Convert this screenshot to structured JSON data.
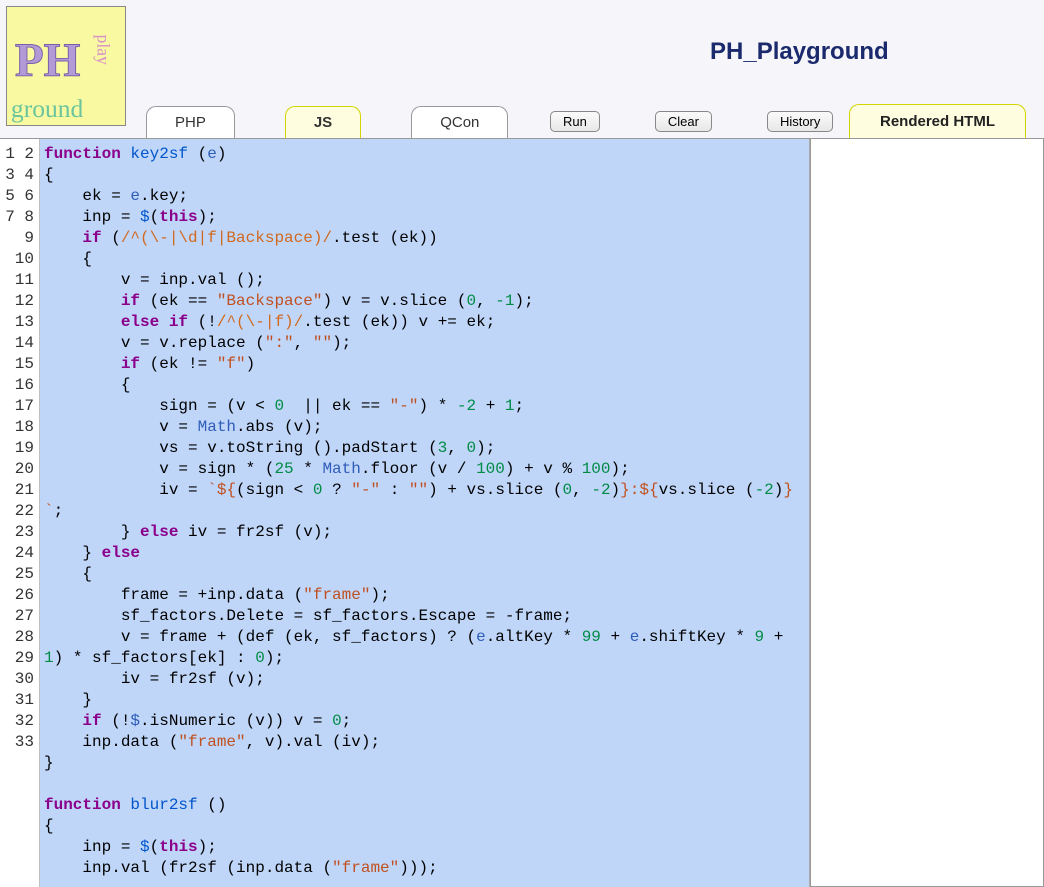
{
  "app_title": "PH_Playground",
  "logo_text": {
    "ph": "PH",
    "play": "play",
    "ground": "ground"
  },
  "tabs": [
    {
      "label": "PHP",
      "active": false
    },
    {
      "label": "JS",
      "active": true
    },
    {
      "label": "QCon",
      "active": false
    }
  ],
  "buttons": {
    "run": "Run",
    "clear": "Clear",
    "history": "History"
  },
  "rendered_tab_label": "Rendered HTML",
  "line_count": 33,
  "code_lines": [
    {
      "n": 1,
      "tokens": [
        {
          "t": "kw",
          "v": "function"
        },
        {
          "t": "",
          "v": " "
        },
        {
          "t": "fn",
          "v": "key2sf"
        },
        {
          "t": "",
          "v": " ("
        },
        {
          "t": "va",
          "v": "e"
        },
        {
          "t": "",
          "v": ")"
        }
      ]
    },
    {
      "n": 2,
      "tokens": [
        {
          "t": "",
          "v": "{"
        }
      ]
    },
    {
      "n": 3,
      "tokens": [
        {
          "t": "",
          "v": "    ek = "
        },
        {
          "t": "va",
          "v": "e"
        },
        {
          "t": "",
          "v": ".key;"
        }
      ]
    },
    {
      "n": 4,
      "tokens": [
        {
          "t": "",
          "v": "    inp = "
        },
        {
          "t": "fn",
          "v": "$"
        },
        {
          "t": "",
          "v": "("
        },
        {
          "t": "kw",
          "v": "this"
        },
        {
          "t": "",
          "v": ");"
        }
      ]
    },
    {
      "n": 5,
      "tokens": [
        {
          "t": "",
          "v": "    "
        },
        {
          "t": "kw",
          "v": "if"
        },
        {
          "t": "",
          "v": " ("
        },
        {
          "t": "re",
          "v": "/^(\\-|\\d|f|Backspace)/"
        },
        {
          "t": "",
          "v": ".test (ek))"
        }
      ]
    },
    {
      "n": 6,
      "tokens": [
        {
          "t": "",
          "v": "    {"
        }
      ]
    },
    {
      "n": 7,
      "tokens": [
        {
          "t": "",
          "v": "        v = inp.val ();"
        }
      ]
    },
    {
      "n": 8,
      "tokens": [
        {
          "t": "",
          "v": "        "
        },
        {
          "t": "kw",
          "v": "if"
        },
        {
          "t": "",
          "v": " (ek == "
        },
        {
          "t": "str",
          "v": "\"Backspace\""
        },
        {
          "t": "",
          "v": ") v = v.slice ("
        },
        {
          "t": "num",
          "v": "0"
        },
        {
          "t": "",
          "v": ", "
        },
        {
          "t": "num",
          "v": "-1"
        },
        {
          "t": "",
          "v": ");"
        }
      ]
    },
    {
      "n": 9,
      "tokens": [
        {
          "t": "",
          "v": "        "
        },
        {
          "t": "kw",
          "v": "else if"
        },
        {
          "t": "",
          "v": " (!"
        },
        {
          "t": "re",
          "v": "/^(\\-|f)/"
        },
        {
          "t": "",
          "v": ".test (ek)) v += ek;"
        }
      ]
    },
    {
      "n": 10,
      "tokens": [
        {
          "t": "",
          "v": "        v = v.replace ("
        },
        {
          "t": "str",
          "v": "\":\""
        },
        {
          "t": "",
          "v": ", "
        },
        {
          "t": "str",
          "v": "\"\""
        },
        {
          "t": "",
          "v": ");"
        }
      ]
    },
    {
      "n": 11,
      "tokens": [
        {
          "t": "",
          "v": "        "
        },
        {
          "t": "kw",
          "v": "if"
        },
        {
          "t": "",
          "v": " (ek != "
        },
        {
          "t": "str",
          "v": "\"f\""
        },
        {
          "t": "",
          "v": ")"
        }
      ]
    },
    {
      "n": 12,
      "tokens": [
        {
          "t": "",
          "v": "        {"
        }
      ]
    },
    {
      "n": 13,
      "tokens": [
        {
          "t": "",
          "v": "            sign = (v < "
        },
        {
          "t": "num",
          "v": "0"
        },
        {
          "t": "",
          "v": "  || ek == "
        },
        {
          "t": "str",
          "v": "\"-\""
        },
        {
          "t": "",
          "v": ") * "
        },
        {
          "t": "num",
          "v": "-2"
        },
        {
          "t": "",
          "v": " + "
        },
        {
          "t": "num",
          "v": "1"
        },
        {
          "t": "",
          "v": ";"
        }
      ]
    },
    {
      "n": 14,
      "tokens": [
        {
          "t": "",
          "v": "            v = "
        },
        {
          "t": "va",
          "v": "Math"
        },
        {
          "t": "",
          "v": ".abs (v);"
        }
      ]
    },
    {
      "n": 15,
      "tokens": [
        {
          "t": "",
          "v": "            vs = v.toString ().padStart ("
        },
        {
          "t": "num",
          "v": "3"
        },
        {
          "t": "",
          "v": ", "
        },
        {
          "t": "num",
          "v": "0"
        },
        {
          "t": "",
          "v": ");"
        }
      ]
    },
    {
      "n": 16,
      "tokens": [
        {
          "t": "",
          "v": "            v = sign * ("
        },
        {
          "t": "num",
          "v": "25"
        },
        {
          "t": "",
          "v": " * "
        },
        {
          "t": "va",
          "v": "Math"
        },
        {
          "t": "",
          "v": ".floor (v / "
        },
        {
          "t": "num",
          "v": "100"
        },
        {
          "t": "",
          "v": ") + v % "
        },
        {
          "t": "num",
          "v": "100"
        },
        {
          "t": "",
          "v": ");"
        }
      ]
    },
    {
      "n": 17,
      "tokens": [
        {
          "t": "",
          "v": "            iv = "
        },
        {
          "t": "str",
          "v": "`${"
        },
        {
          "t": "",
          "v": "(sign < "
        },
        {
          "t": "num",
          "v": "0"
        },
        {
          "t": "",
          "v": " ? "
        },
        {
          "t": "str",
          "v": "\"-\""
        },
        {
          "t": "",
          "v": " : "
        },
        {
          "t": "str",
          "v": "\"\""
        },
        {
          "t": "",
          "v": ") + vs.slice ("
        },
        {
          "t": "num",
          "v": "0"
        },
        {
          "t": "",
          "v": ", "
        },
        {
          "t": "num",
          "v": "-2"
        },
        {
          "t": "",
          "v": ")"
        },
        {
          "t": "str",
          "v": "}:${"
        },
        {
          "t": "",
          "v": "vs.slice ("
        },
        {
          "t": "num",
          "v": "-2"
        },
        {
          "t": "",
          "v": ")"
        },
        {
          "t": "str",
          "v": "}`"
        },
        {
          "t": "",
          "v": ";"
        }
      ]
    },
    {
      "n": 18,
      "tokens": [
        {
          "t": "",
          "v": "        } "
        },
        {
          "t": "kw",
          "v": "else"
        },
        {
          "t": "",
          "v": " iv = fr2sf (v);"
        }
      ]
    },
    {
      "n": 19,
      "tokens": [
        {
          "t": "",
          "v": "    } "
        },
        {
          "t": "kw",
          "v": "else"
        }
      ]
    },
    {
      "n": 20,
      "tokens": [
        {
          "t": "",
          "v": "    {"
        }
      ]
    },
    {
      "n": 21,
      "tokens": [
        {
          "t": "",
          "v": "        frame = +inp.data ("
        },
        {
          "t": "str",
          "v": "\"frame\""
        },
        {
          "t": "",
          "v": ");"
        }
      ]
    },
    {
      "n": 22,
      "tokens": [
        {
          "t": "",
          "v": "        sf_factors.Delete = sf_factors.Escape = -frame;"
        }
      ]
    },
    {
      "n": 23,
      "tokens": [
        {
          "t": "",
          "v": "        v = frame + (def (ek, sf_factors) ? ("
        },
        {
          "t": "va",
          "v": "e"
        },
        {
          "t": "",
          "v": ".altKey * "
        },
        {
          "t": "num",
          "v": "99"
        },
        {
          "t": "",
          "v": " + "
        },
        {
          "t": "va",
          "v": "e"
        },
        {
          "t": "",
          "v": ".shiftKey * "
        },
        {
          "t": "num",
          "v": "9"
        },
        {
          "t": "",
          "v": " + "
        },
        {
          "t": "num",
          "v": "1"
        },
        {
          "t": "",
          "v": ") * sf_factors[ek] : "
        },
        {
          "t": "num",
          "v": "0"
        },
        {
          "t": "",
          "v": ");"
        }
      ]
    },
    {
      "n": 24,
      "tokens": [
        {
          "t": "",
          "v": "        iv = fr2sf (v);"
        }
      ]
    },
    {
      "n": 25,
      "tokens": [
        {
          "t": "",
          "v": "    }"
        }
      ]
    },
    {
      "n": 26,
      "tokens": [
        {
          "t": "",
          "v": "    "
        },
        {
          "t": "kw",
          "v": "if"
        },
        {
          "t": "",
          "v": " (!"
        },
        {
          "t": "va",
          "v": "$"
        },
        {
          "t": "",
          "v": ".isNumeric (v)) v = "
        },
        {
          "t": "num",
          "v": "0"
        },
        {
          "t": "",
          "v": ";"
        }
      ]
    },
    {
      "n": 27,
      "tokens": [
        {
          "t": "",
          "v": "    inp.data ("
        },
        {
          "t": "str",
          "v": "\"frame\""
        },
        {
          "t": "",
          "v": ", v).val (iv);"
        }
      ]
    },
    {
      "n": 28,
      "tokens": [
        {
          "t": "",
          "v": "}"
        }
      ]
    },
    {
      "n": 29,
      "tokens": [
        {
          "t": "",
          "v": ""
        }
      ]
    },
    {
      "n": 30,
      "tokens": [
        {
          "t": "kw",
          "v": "function"
        },
        {
          "t": "",
          "v": " "
        },
        {
          "t": "fn",
          "v": "blur2sf"
        },
        {
          "t": "",
          "v": " ()"
        }
      ]
    },
    {
      "n": 31,
      "tokens": [
        {
          "t": "",
          "v": "{"
        }
      ]
    },
    {
      "n": 32,
      "tokens": [
        {
          "t": "",
          "v": "    inp = "
        },
        {
          "t": "fn",
          "v": "$"
        },
        {
          "t": "",
          "v": "("
        },
        {
          "t": "kw",
          "v": "this"
        },
        {
          "t": "",
          "v": ");"
        }
      ]
    },
    {
      "n": 33,
      "tokens": [
        {
          "t": "",
          "v": "    inp.val (fr2sf (inp.data ("
        },
        {
          "t": "str",
          "v": "\"frame\""
        },
        {
          "t": "",
          "v": ")));"
        }
      ]
    }
  ]
}
